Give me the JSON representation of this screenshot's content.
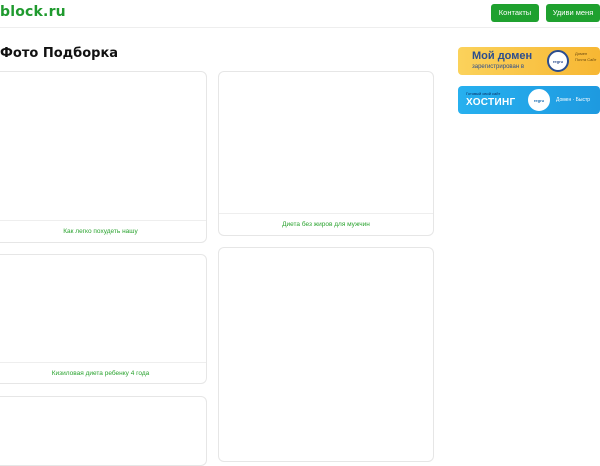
{
  "header": {
    "logo": "block.ru",
    "contacts_label": "Контакты",
    "surprise_label": "Удиви меня"
  },
  "page": {
    "title": "Фото Подборка"
  },
  "cards": [
    {
      "caption": "Как легко похудеть нашу"
    },
    {
      "caption": "Диета без жиров для мужчин"
    },
    {
      "caption": "Кизиловая диета ребенку 4 года"
    },
    {
      "caption": ""
    },
    {
      "caption": ""
    }
  ],
  "ads": {
    "domain": {
      "title": "Мой домен",
      "subtitle": "зарегистрирован в",
      "logo_text": "regru",
      "side_text": "Домен Почта Сайт"
    },
    "hosting": {
      "small": "Готовый свой сайт",
      "title": "ХОСТИНГ",
      "logo_text": "regru",
      "right_text": "Домен · Быстр"
    }
  },
  "colors": {
    "brand_green": "#1fa12f",
    "caption_green": "#2aa32f",
    "ad_domain_bg": "#f7b733",
    "ad_hosting_bg": "#27b0ef"
  }
}
